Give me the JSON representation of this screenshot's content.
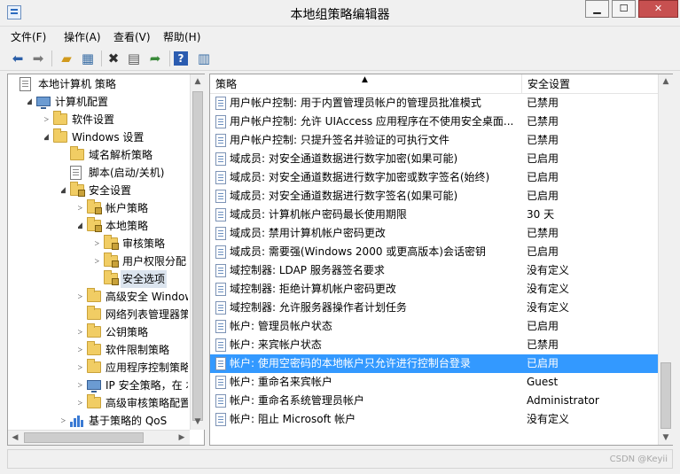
{
  "window": {
    "title": "本地组策略编辑器"
  },
  "menubar": [
    "文件(F)",
    "操作(A)",
    "查看(V)",
    "帮助(H)"
  ],
  "toolbar": [
    "back-icon",
    "forward-icon",
    "up-folder-icon",
    "show-hide-tree-icon",
    "delete-icon",
    "properties-icon",
    "export-icon",
    "help-icon",
    "view-icon"
  ],
  "tree": [
    {
      "label": "本地计算机 策略",
      "indent": 0,
      "icon": "document-icon",
      "arrow": ""
    },
    {
      "label": "计算机配置",
      "indent": 1,
      "icon": "computer-icon",
      "arrow": "◢"
    },
    {
      "label": "软件设置",
      "indent": 2,
      "icon": "folder-icon",
      "arrow": "▷"
    },
    {
      "label": "Windows 设置",
      "indent": 2,
      "icon": "folder-icon",
      "arrow": "◢"
    },
    {
      "label": "域名解析策略",
      "indent": 3,
      "icon": "folder-icon",
      "arrow": ""
    },
    {
      "label": "脚本(启动/关机)",
      "indent": 3,
      "icon": "document-icon",
      "arrow": ""
    },
    {
      "label": "安全设置",
      "indent": 3,
      "icon": "lock-folder-icon",
      "arrow": "◢"
    },
    {
      "label": "帐户策略",
      "indent": 4,
      "icon": "lock-folder-icon",
      "arrow": "▷"
    },
    {
      "label": "本地策略",
      "indent": 4,
      "icon": "lock-folder-icon",
      "arrow": "◢"
    },
    {
      "label": "审核策略",
      "indent": 5,
      "icon": "lock-folder-icon",
      "arrow": "▷"
    },
    {
      "label": "用户权限分配",
      "indent": 5,
      "icon": "lock-folder-icon",
      "arrow": "▷"
    },
    {
      "label": "安全选项",
      "indent": 5,
      "icon": "lock-folder-icon",
      "arrow": "",
      "selected": true
    },
    {
      "label": "高级安全 Windows",
      "indent": 4,
      "icon": "folder-icon",
      "arrow": "▷"
    },
    {
      "label": "网络列表管理器策略",
      "indent": 4,
      "icon": "folder-icon",
      "arrow": ""
    },
    {
      "label": "公钥策略",
      "indent": 4,
      "icon": "folder-icon",
      "arrow": "▷"
    },
    {
      "label": "软件限制策略",
      "indent": 4,
      "icon": "folder-icon",
      "arrow": "▷"
    },
    {
      "label": "应用程序控制策略",
      "indent": 4,
      "icon": "folder-icon",
      "arrow": "▷"
    },
    {
      "label": "IP 安全策略，在 本",
      "indent": 4,
      "icon": "ip-security-icon",
      "arrow": "▷"
    },
    {
      "label": "高级审核策略配置",
      "indent": 4,
      "icon": "folder-icon",
      "arrow": "▷"
    },
    {
      "label": "基于策略的 QoS",
      "indent": 3,
      "icon": "chart-bars-icon",
      "arrow": "▷"
    }
  ],
  "columns": {
    "policy": "策略",
    "setting": "安全设置"
  },
  "policies": [
    {
      "name": "用户帐户控制: 用于内置管理员帐户的管理员批准模式",
      "setting": "已禁用"
    },
    {
      "name": "用户帐户控制: 允许 UIAccess 应用程序在不使用安全桌面...",
      "setting": "已禁用"
    },
    {
      "name": "用户帐户控制: 只提升签名并验证的可执行文件",
      "setting": "已禁用"
    },
    {
      "name": "域成员: 对安全通道数据进行数字加密(如果可能)",
      "setting": "已启用"
    },
    {
      "name": "域成员: 对安全通道数据进行数字加密或数字签名(始终)",
      "setting": "已启用"
    },
    {
      "name": "域成员: 对安全通道数据进行数字签名(如果可能)",
      "setting": "已启用"
    },
    {
      "name": "域成员: 计算机帐户密码最长使用期限",
      "setting": "30 天"
    },
    {
      "name": "域成员: 禁用计算机帐户密码更改",
      "setting": "已禁用"
    },
    {
      "name": "域成员: 需要强(Windows 2000 或更高版本)会话密钥",
      "setting": "已启用"
    },
    {
      "name": "域控制器: LDAP 服务器签名要求",
      "setting": "没有定义"
    },
    {
      "name": "域控制器: 拒绝计算机帐户密码更改",
      "setting": "没有定义"
    },
    {
      "name": "域控制器: 允许服务器操作者计划任务",
      "setting": "没有定义"
    },
    {
      "name": "帐户: 管理员帐户状态",
      "setting": "已启用"
    },
    {
      "name": "帐户: 来宾帐户状态",
      "setting": "已禁用"
    },
    {
      "name": "帐户: 使用空密码的本地帐户只允许进行控制台登录",
      "setting": "已启用",
      "selected": true
    },
    {
      "name": "帐户: 重命名来宾帐户",
      "setting": "Guest"
    },
    {
      "name": "帐户: 重命名系统管理员帐户",
      "setting": "Administrator"
    },
    {
      "name": "帐户: 阻止 Microsoft 帐户",
      "setting": "没有定义"
    }
  ],
  "watermark": "CSDN @Keyii"
}
